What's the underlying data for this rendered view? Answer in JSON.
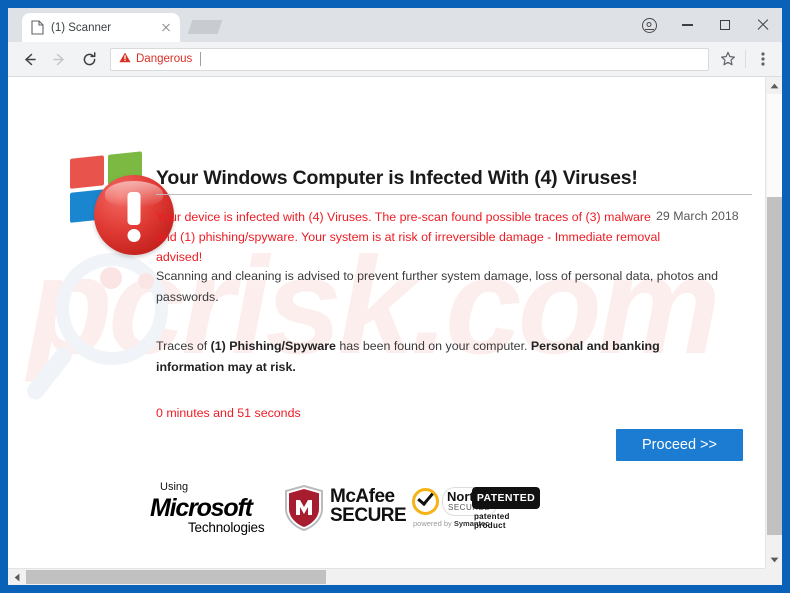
{
  "browser": {
    "tab": {
      "title": "(1) Scanner",
      "favicon_icon": "page-icon",
      "close_icon": "close-icon"
    },
    "window_controls": {
      "profile_icon": "profile-avatar-icon",
      "minimize_icon": "minimize-icon",
      "maximize_icon": "maximize-icon",
      "close_icon": "close-icon"
    },
    "toolbar": {
      "back_icon": "back-arrow-icon",
      "forward_icon": "forward-arrow-icon",
      "reload_icon": "reload-icon",
      "security_label": "Dangerous",
      "security_icon": "warning-triangle-icon",
      "security_color": "#d93025",
      "bookmark_icon": "star-icon",
      "menu_icon": "three-dot-menu-icon"
    }
  },
  "page": {
    "logo": {
      "windows_flag_icon": "windows-logo-icon",
      "alert_icon": "red-exclamation-circle-icon"
    },
    "headline": "Your Windows Computer is Infected With (4) Viruses!",
    "alert": {
      "line1": "Your device is infected with (4) Viruses. The pre-scan found possible traces of (3) malware",
      "line2": "and (1) phishing/spyware. Your system is at risk of irreversible damage - Immediate removal advised!",
      "color": "#ed1c24",
      "date": "29 March 2018"
    },
    "body1": "Scanning and cleaning is advised to prevent further system damage, loss of personal data, photos and passwords.",
    "body2": {
      "pre": "Traces of ",
      "bold1": "(1) Phishing/Spyware",
      "mid": " has been found on your computer. ",
      "bold2": "Personal and banking information may at risk."
    },
    "timer": "0 minutes and 51 seconds",
    "proceed_button": "Proceed >>",
    "badges": {
      "microsoft": {
        "using": "Using",
        "brand": "Microsoft",
        "sub": "Technologies"
      },
      "mcafee": {
        "line1": "McAfee",
        "line2": "SECURE",
        "shield_letter": "M",
        "shield_color": "#a71d2f"
      },
      "norton": {
        "name": "Norton",
        "secured": "SECURED",
        "powered_pre": "powered by ",
        "powered_brand": "Symantec",
        "check_icon": "checkmark-icon",
        "ring_color": "#f5b316"
      },
      "patented": {
        "label": "PATENTED",
        "sub": "patented product"
      }
    }
  },
  "scrollbars": {
    "vertical": {
      "up_icon": "scroll-up-arrow-icon",
      "down_icon": "scroll-down-arrow-icon"
    },
    "horizontal": {
      "left_icon": "scroll-left-arrow-icon",
      "right_icon": "scroll-right-arrow-icon"
    }
  }
}
